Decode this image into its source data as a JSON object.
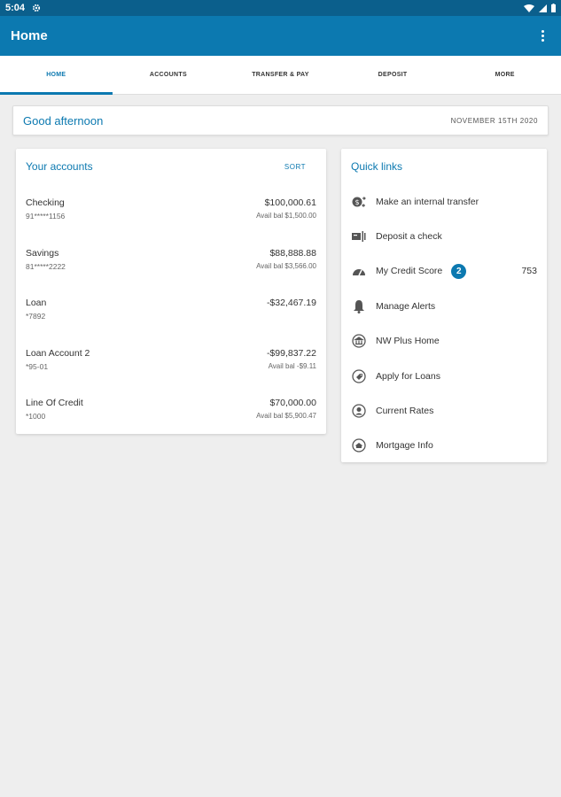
{
  "status_bar": {
    "time": "5:04"
  },
  "app_bar": {
    "title": "Home"
  },
  "tabs": [
    {
      "label": "HOME",
      "active": true
    },
    {
      "label": "ACCOUNTS",
      "active": false
    },
    {
      "label": "TRANSFER & PAY",
      "active": false
    },
    {
      "label": "DEPOSIT",
      "active": false
    },
    {
      "label": "MORE",
      "active": false
    }
  ],
  "greeting": {
    "text": "Good afternoon",
    "date": "NOVEMBER 15TH 2020"
  },
  "accounts": {
    "title": "Your accounts",
    "sort_label": "SORT",
    "items": [
      {
        "name": "Checking",
        "number": "91*****1156",
        "balance": "$100,000.61",
        "available": "Avail bal $1,500.00"
      },
      {
        "name": "Savings",
        "number": "81*****2222",
        "balance": "$88,888.88",
        "available": "Avail bal $3,566.00"
      },
      {
        "name": "Loan",
        "number": "*7892",
        "balance": "-$32,467.19",
        "available": ""
      },
      {
        "name": "Loan Account 2",
        "number": "*95-01",
        "balance": "-$99,837.22",
        "available": "Avail bal -$9.11"
      },
      {
        "name": "Line Of Credit",
        "number": "*1000",
        "balance": "$70,000.00",
        "available": "Avail bal $5,900.47"
      }
    ]
  },
  "quick_links": {
    "title": "Quick links",
    "items": [
      {
        "label": "Make an internal transfer",
        "icon": "transfer-icon"
      },
      {
        "label": "Deposit a check",
        "icon": "check-deposit-icon"
      },
      {
        "label": "My Credit Score",
        "icon": "gauge-icon",
        "badge": "2",
        "score": "753"
      },
      {
        "label": "Manage Alerts",
        "icon": "bell-icon"
      },
      {
        "label": "NW Plus Home",
        "icon": "bank-icon"
      },
      {
        "label": "Apply for Loans",
        "icon": "tag-icon"
      },
      {
        "label": "Current Rates",
        "icon": "rates-icon"
      },
      {
        "label": "Mortgage Info",
        "icon": "house-icon"
      }
    ]
  },
  "colors": {
    "status_bar": "#0b5f8c",
    "app_bar": "#0c79b0",
    "accent": "#0c79b0",
    "background": "#eeeeee"
  }
}
